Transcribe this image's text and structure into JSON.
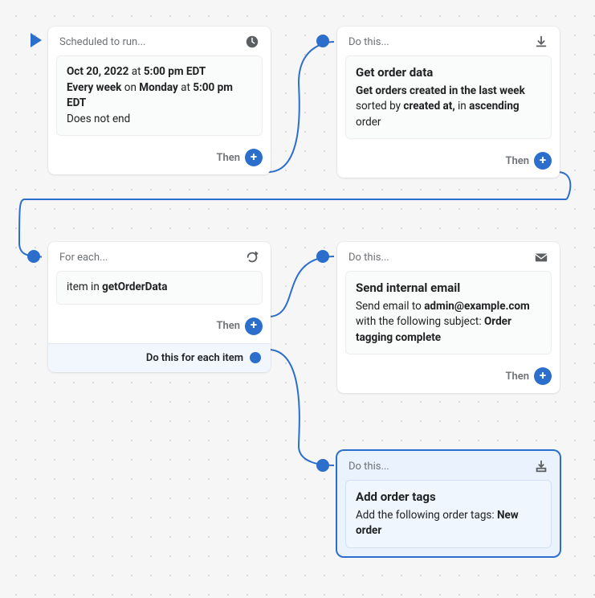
{
  "accent": "#2c6ecb",
  "then_label": "Then",
  "node1": {
    "header": "Scheduled to run...",
    "desc_html": "<b>Oct 20, 2022</b> at <b>5:00 pm EDT</b><br><b>Every week</b> on <b>Monday</b> at <b>5:00 pm EDT</b><br>Does not end"
  },
  "node2": {
    "header": "Do this...",
    "title": "Get order data",
    "desc_html": "<b>Get orders created in the last week</b> sorted by <b>created at,</b> in <b>ascending</b> order"
  },
  "node3": {
    "header": "For each...",
    "desc_html": "item in <b>getOrderData</b>",
    "footer": "Do this for each item"
  },
  "node4": {
    "header": "Do this...",
    "title": "Send internal email",
    "desc_html": "Send email to <b>admin@example.com</b> with the following subject: <b>Order tagging complete</b>"
  },
  "node5": {
    "header": "Do this...",
    "title": "Add order tags",
    "desc_html": "Add the following order tags: <b>New order</b>"
  }
}
